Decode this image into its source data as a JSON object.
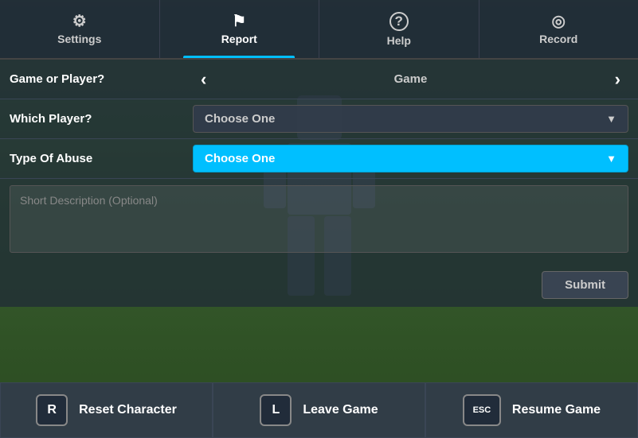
{
  "nav": {
    "items": [
      {
        "id": "settings",
        "label": "Settings",
        "icon": "⚙",
        "active": false
      },
      {
        "id": "report",
        "label": "Report",
        "icon": "⚑",
        "active": true
      },
      {
        "id": "help",
        "label": "Help",
        "icon": "?",
        "active": false
      },
      {
        "id": "record",
        "label": "Record",
        "icon": "◎",
        "active": false
      }
    ]
  },
  "form": {
    "game_or_player_label": "Game or Player?",
    "current_game_value": "Game",
    "which_player_label": "Which Player?",
    "which_player_placeholder": "Choose One",
    "type_of_abuse_label": "Type Of Abuse",
    "type_of_abuse_placeholder": "Choose One",
    "description_placeholder": "Short Description (Optional)",
    "submit_label": "Submit"
  },
  "bottom_actions": [
    {
      "key": "R",
      "label": "Reset Character"
    },
    {
      "key": "L",
      "label": "Leave Game"
    },
    {
      "key": "ESC",
      "label": "Resume Game"
    }
  ]
}
